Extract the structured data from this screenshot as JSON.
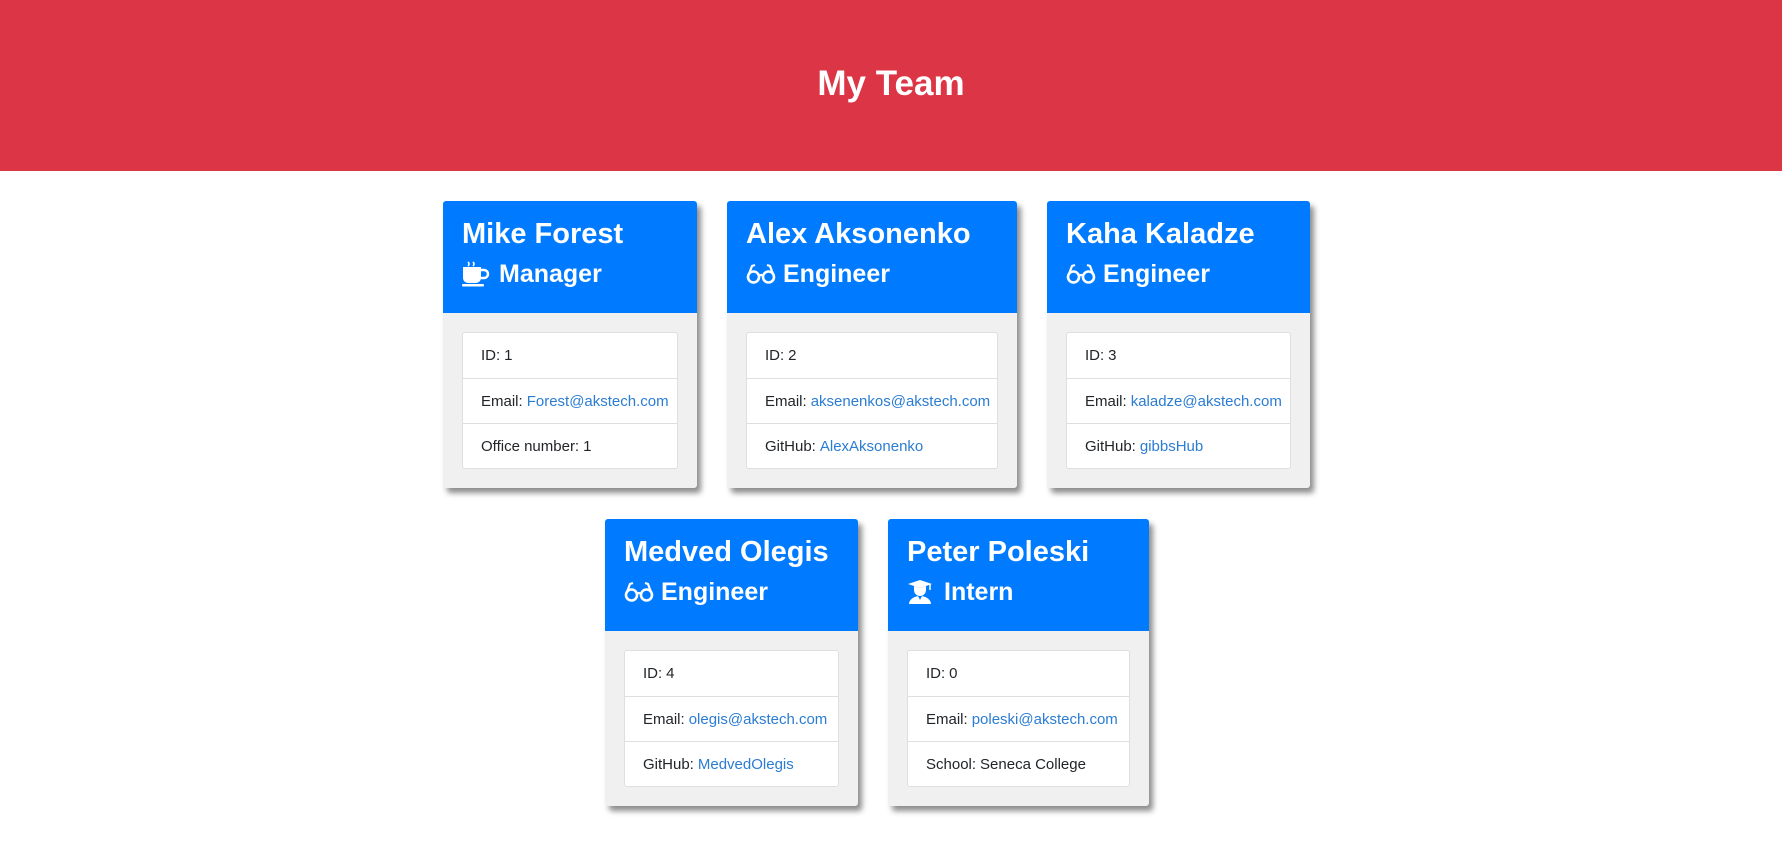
{
  "header": {
    "title": "My Team"
  },
  "members": [
    {
      "name": "Mike Forest",
      "role": "Manager",
      "icon": "coffee-icon",
      "id_label": "ID:",
      "id": "1",
      "email_label": "Email:",
      "email": "Forest@akstech.com",
      "extra_label": "Office number:",
      "extra": "1",
      "extra_is_link": false
    },
    {
      "name": "Alex Aksonenko",
      "role": "Engineer",
      "icon": "glasses-icon",
      "id_label": "ID:",
      "id": "2",
      "email_label": "Email:",
      "email": "aksenenkos@akstech.com",
      "extra_label": "GitHub:",
      "extra": "AlexAksonenko",
      "extra_is_link": true
    },
    {
      "name": "Kaha Kaladze",
      "role": "Engineer",
      "icon": "glasses-icon",
      "id_label": "ID:",
      "id": "3",
      "email_label": "Email:",
      "email": "kaladze@akstech.com",
      "extra_label": "GitHub:",
      "extra": "gibbsHub",
      "extra_is_link": true
    },
    {
      "name": "Medved Olegis",
      "role": "Engineer",
      "icon": "glasses-icon",
      "id_label": "ID:",
      "id": "4",
      "email_label": "Email:",
      "email": "olegis@akstech.com",
      "extra_label": "GitHub:",
      "extra": "MedvedOlegis",
      "extra_is_link": true
    },
    {
      "name": "Peter Poleski",
      "role": "Intern",
      "icon": "graduate-icon",
      "id_label": "ID:",
      "id": "0",
      "email_label": "Email:",
      "email": "poleski@akstech.com",
      "extra_label": "School:",
      "extra": "Seneca College",
      "extra_is_link": false
    }
  ],
  "colors": {
    "header_bg": "#dc3545",
    "card_header_bg": "#007bff",
    "link": "#2b7cd3"
  }
}
